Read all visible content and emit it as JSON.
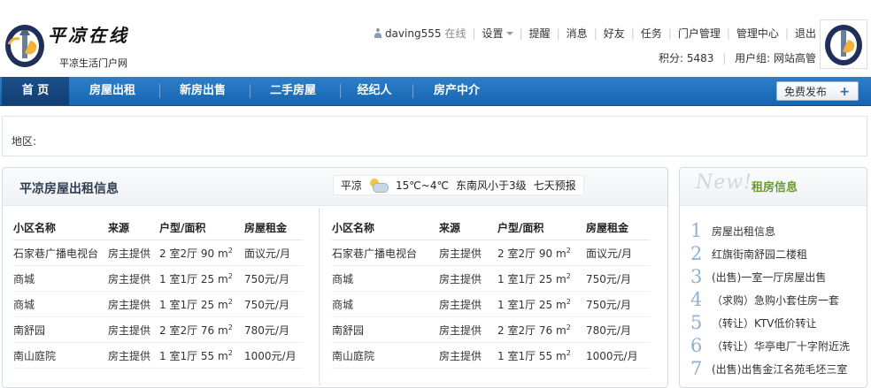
{
  "header": {
    "site_name": "平凉在线",
    "site_sub": "平凉生活门户网",
    "username": "daving555",
    "online": "在线",
    "links": [
      "设置",
      "提醒",
      "消息",
      "好友",
      "任务",
      "门户管理",
      "管理中心",
      "退出"
    ],
    "credits": "积分: 5483",
    "group": "用户组: 网站高管"
  },
  "nav": {
    "items": [
      "首 页",
      "房屋出租",
      "新房出售",
      "二手房屋",
      "经纪人",
      "房产中介"
    ],
    "publish": "免费发布",
    "publish_icon": "+"
  },
  "region": {
    "label": "地区:"
  },
  "main": {
    "title": "平凉房屋出租信息",
    "weather": {
      "city": "平凉",
      "temp": "15℃~4℃",
      "wind": "东南风小于3级",
      "forecast": "七天预报",
      "icon": "cloud-sun-icon"
    },
    "columns": [
      "小区名称",
      "来源",
      "户型/面积",
      "房屋租金"
    ],
    "rows_left": [
      {
        "name": "石家巷广播电视台",
        "source": "房主提供",
        "layout": "2 室2厅 90 m",
        "rent": "面议元/月"
      },
      {
        "name": "商城",
        "source": "房主提供",
        "layout": "1 室1厅 25 m",
        "rent": "750元/月"
      },
      {
        "name": "商城",
        "source": "房主提供",
        "layout": "1 室1厅 25 m",
        "rent": "750元/月"
      },
      {
        "name": "南舒园",
        "source": "房主提供",
        "layout": "2 室2厅 76 m",
        "rent": "780元/月"
      },
      {
        "name": "南山庭院",
        "source": "房主提供",
        "layout": "1 室1厅 55 m",
        "rent": "1000元/月"
      }
    ],
    "rows_right": [
      {
        "name": "石家巷广播电视台",
        "source": "房主提供",
        "layout": "2 室2厅 90 m",
        "rent": "面议元/月"
      },
      {
        "name": "商城",
        "source": "房主提供",
        "layout": "1 室1厅 25 m",
        "rent": "750元/月"
      },
      {
        "name": "商城",
        "source": "房主提供",
        "layout": "1 室1厅 25 m",
        "rent": "750元/月"
      },
      {
        "name": "南舒园",
        "source": "房主提供",
        "layout": "2 室2厅 76 m",
        "rent": "780元/月"
      },
      {
        "name": "南山庭院",
        "source": "房主提供",
        "layout": "1 室1厅 55 m",
        "rent": "1000元/月"
      }
    ],
    "area_sup": "2"
  },
  "side": {
    "badge": "New!",
    "title": "租房信息",
    "items": [
      {
        "num": "1",
        "text": "房屋出租信息"
      },
      {
        "num": "2",
        "text": "红旗街南舒园二楼租"
      },
      {
        "num": "3",
        "text": "(出售)一室一厅房屋出售"
      },
      {
        "num": "4",
        "text": "（求购）急购小套住房一套"
      },
      {
        "num": "5",
        "text": "（转让）KTV低价转让"
      },
      {
        "num": "6",
        "text": "（转让）华亭电厂十字附近洗"
      },
      {
        "num": "7",
        "text": "(出售)出售金江名苑毛坯三室"
      }
    ]
  },
  "colors": {
    "nav_blue": "#1a6dbd",
    "accent_green": "#6a9a2f"
  }
}
